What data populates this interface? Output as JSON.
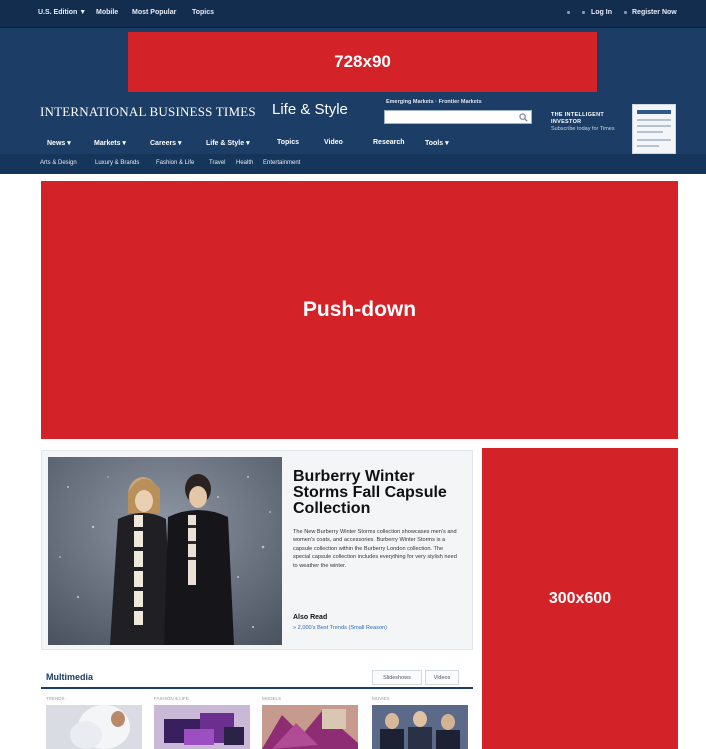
{
  "topbar": {
    "edition": "U.S. Edition ▼",
    "mobile": "Mobile",
    "most_popular": "Most Popular",
    "topics": "Topics",
    "login": "Log In",
    "register": "Register Now"
  },
  "ads": {
    "leaderboard": "728x90",
    "pushdown": "Push-down",
    "skyscraper": "300x600"
  },
  "header": {
    "brand": "INTERNATIONAL BUSINESS TIMES",
    "section": "Life & Style",
    "search_label": "Emerging Markets · Frontier Markets",
    "promo_title_1": "THE INTELLIGENT",
    "promo_title_2": "INVESTOR",
    "promo_sub": "Subscribe today for Times"
  },
  "mainnav": [
    "News ▾",
    "Markets ▾",
    "Careers ▾",
    "Life & Style ▾",
    "Topics",
    "Video",
    "Research",
    "Tools ▾"
  ],
  "subnav": [
    "Arts & Design",
    "Luxury & Brands",
    "Fashion & Life",
    "Travel",
    "Health",
    "Entertainment"
  ],
  "feature": {
    "title": "Burberry Winter Storms Fall Capsule Collection",
    "body": "The New Burberry Winter Storms collection showcases men's and women's coats, and accessories. Burberry Winter Storms is a capsule collection within the Burberry London collection. The special capsule collection includes everything for very stylish need to weather the winter.",
    "also_read": "Also Read",
    "link": "» 2,000's Best Trends (Small Reason)"
  },
  "multimedia": {
    "title": "Multimedia",
    "tab1": "Slideshows",
    "tab2": "Videos",
    "cats": [
      "Trends",
      "Fashion & Life",
      "Models",
      "Movies"
    ]
  }
}
